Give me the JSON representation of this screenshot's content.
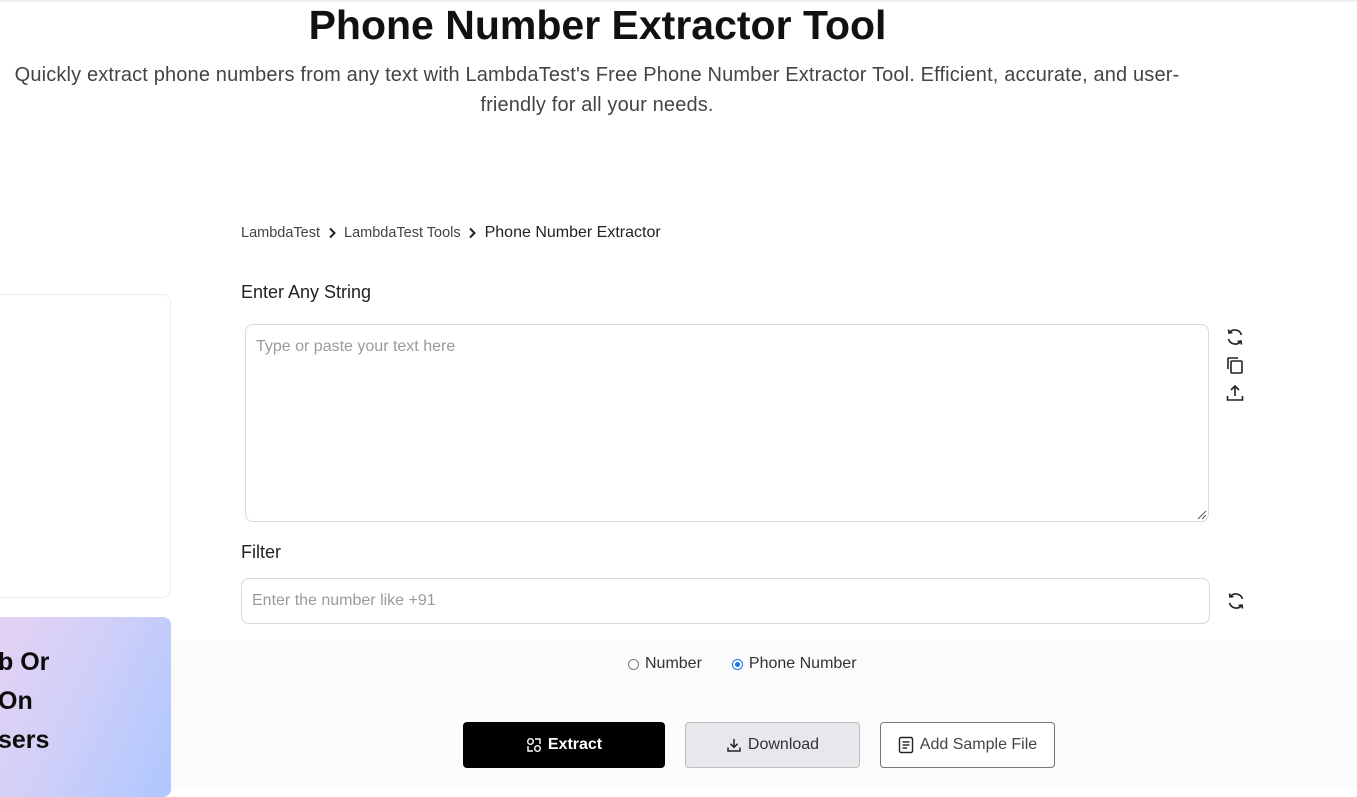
{
  "hero": {
    "title": "Phone Number Extractor Tool",
    "subtitle": "Quickly extract phone numbers from any text with LambdaTest's Free Phone Number Extractor Tool. Efficient, accurate, and user-friendly for all your needs."
  },
  "promo": {
    "lines": [
      "b Or",
      "On",
      "sers"
    ]
  },
  "breadcrumb": {
    "items": [
      "LambdaTest",
      "LambdaTest Tools"
    ],
    "current": "Phone Number Extractor"
  },
  "input_section": {
    "label": "Enter Any String",
    "value": "",
    "placeholder": "Type or paste your text here",
    "icons": [
      "refresh-icon",
      "copy-icon",
      "upload-icon"
    ]
  },
  "filter": {
    "label": "Filter",
    "value": "",
    "placeholder": "Enter the number like +91",
    "icon": "refresh-icon"
  },
  "mode": {
    "options": [
      "Number",
      "Phone Number"
    ],
    "selected": "Phone Number"
  },
  "actions": {
    "extract_label": "Extract",
    "download_label": "Download",
    "sample_label": "Add Sample File"
  },
  "colors": {
    "primary_button": "#000000",
    "radio_accent": "#1a73e8"
  }
}
